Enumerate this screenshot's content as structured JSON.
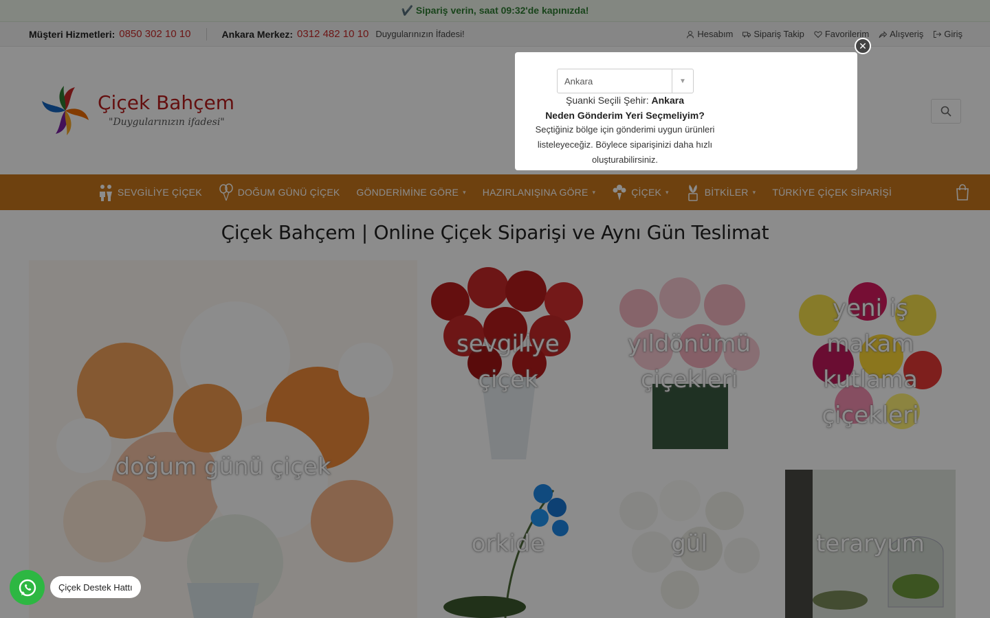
{
  "promo": {
    "text": "✔️ Sipariş verin, saat 09:32'de kapınızda!"
  },
  "topbar": {
    "customer_service_label": "Müşteri Hizmetleri:",
    "customer_service_phone": "0850 302 10 10",
    "branch_label": "Ankara Merkez:",
    "branch_phone": "0312 482 10 10",
    "tagline": "Duygularınızın İfadesi!",
    "links": {
      "account": "Hesabım",
      "order_tracking": "Sipariş Takip",
      "favorites": "Favorilerim",
      "shopping": "Alışveriş",
      "login": "Giriş"
    }
  },
  "logo": {
    "name": "Çiçek Bahçem",
    "slogan": "\"Duygularınızın ifadesi\""
  },
  "nav": {
    "items": [
      {
        "label": "SEVGİLİYE ÇİÇEK",
        "icon": "couple-icon",
        "dropdown": false
      },
      {
        "label": "DOĞUM GÜNÜ ÇİÇEK",
        "icon": "balloon-icon",
        "dropdown": false
      },
      {
        "label": "GÖNDERİMİNE GÖRE",
        "icon": "",
        "dropdown": true
      },
      {
        "label": "HAZIRLANIŞINA GÖRE",
        "icon": "",
        "dropdown": true
      },
      {
        "label": "ÇİÇEK",
        "icon": "bouquet-icon",
        "dropdown": true
      },
      {
        "label": "BİTKİLER",
        "icon": "plant-icon",
        "dropdown": true
      },
      {
        "label": "TÜRKİYE ÇİÇEK SİPARİŞİ",
        "icon": "",
        "dropdown": false
      }
    ]
  },
  "page_title": "Çiçek Bahçem | Online Çiçek Siparişi ve Aynı Gün Teslimat",
  "tiles": {
    "t1": "doğum günü çiçek",
    "t2": "sevgiliye çiçek",
    "t3": "yıldönümü çiçekleri",
    "t4": "yeni iş makam kutlama çiçekleri",
    "t5": "orkide",
    "t6": "gül",
    "t7": "teraryum"
  },
  "modal": {
    "selected_city": "Ankara",
    "current_label": "Şuanki Seçili Şehir:",
    "current_city": "Ankara",
    "why_title": "Neden Gönderim Yeri Seçmeliyim?",
    "description": "Seçtiğiniz bölge için gönderimi uygun ürünleri listeleyeceğiz. Böylece siparişinizi daha hızlı oluşturabilirsiniz."
  },
  "support": {
    "label": "Çiçek Destek Hattı"
  },
  "colors": {
    "nav_bg": "#c8771c",
    "phone": "#c62828",
    "promo_text": "#2e7d32",
    "whatsapp": "#2db742"
  }
}
